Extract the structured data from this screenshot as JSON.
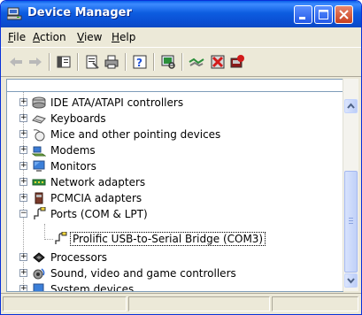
{
  "window": {
    "title": "Device Manager"
  },
  "menu": [
    {
      "label": "File",
      "mnemonic_first": "F",
      "rest": "ile"
    },
    {
      "label": "Action",
      "mnemonic_first": "A",
      "rest": "ction"
    },
    {
      "label": "View",
      "mnemonic_first": "V",
      "rest": "iew"
    },
    {
      "label": "Help",
      "mnemonic_first": "H",
      "rest": "elp"
    }
  ],
  "toolbar": {
    "buttons": [
      "back-arrow-icon",
      "forward-arrow-icon",
      "console-tree-icon",
      "properties-icon",
      "print-icon",
      "help-icon",
      "scan-hardware-icon",
      "update-driver-icon",
      "uninstall-icon",
      "disable-icon"
    ]
  },
  "tree": {
    "items": [
      {
        "label": "IDE ATA/ATAPI controllers",
        "icon": "ide-controller-icon",
        "expander": "+"
      },
      {
        "label": "Keyboards",
        "icon": "keyboard-icon",
        "expander": "+"
      },
      {
        "label": "Mice and other pointing devices",
        "icon": "mouse-icon",
        "expander": "+"
      },
      {
        "label": "Modems",
        "icon": "modem-icon",
        "expander": "+"
      },
      {
        "label": "Monitors",
        "icon": "monitor-icon",
        "expander": "+"
      },
      {
        "label": "Network adapters",
        "icon": "network-adapter-icon",
        "expander": "+"
      },
      {
        "label": "PCMCIA adapters",
        "icon": "pcmcia-icon",
        "expander": "+"
      },
      {
        "label": "Ports (COM & LPT)",
        "icon": "port-icon",
        "expander": "−"
      },
      {
        "label": "Prolific USB-to-Serial Bridge (COM3)",
        "icon": "port-icon",
        "child": true
      },
      {
        "label": "Processors",
        "icon": "processor-icon",
        "expander": "+"
      },
      {
        "label": "Sound, video and game controllers",
        "icon": "sound-icon",
        "expander": "+"
      },
      {
        "label": "System devices",
        "icon": "system-icon",
        "expander": "+"
      }
    ]
  },
  "colors": {
    "titlebar": "#0a4ed3",
    "chrome": "#ece9d8",
    "close_button": "#c8401f"
  }
}
